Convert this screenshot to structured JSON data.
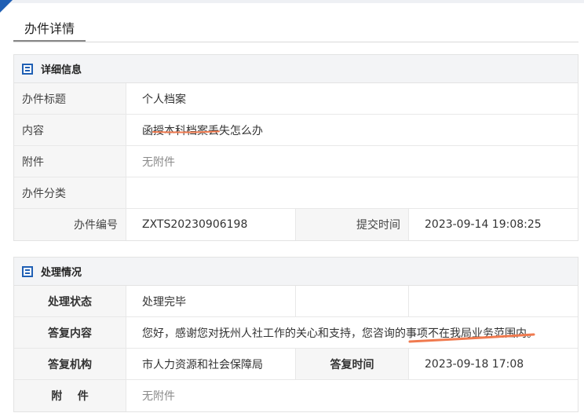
{
  "page": {
    "title": "办件详情"
  },
  "detail": {
    "header": "详细信息",
    "title_label": "办件标题",
    "title_value": "个人档案",
    "content_label": "内容",
    "content_value": "函授本科档案丢失怎么办",
    "attachment_label": "附件",
    "attachment_value": "无附件",
    "category_label": "办件分类",
    "category_value": "",
    "number_label": "办件编号",
    "number_value": "ZXTS20230906198",
    "submit_time_label": "提交时间",
    "submit_time_value": "2023-09-14 19:08:25"
  },
  "handling": {
    "header": "处理情况",
    "status_label": "处理状态",
    "status_value": "处理完毕",
    "reply_label": "答复内容",
    "reply_value": "您好，感谢您对抚州人社工作的关心和支持，您咨询的事项不在我局业务范围内。",
    "org_label": "答复机构",
    "org_value": "市人力资源和社会保障局",
    "reply_time_label": "答复时间",
    "reply_time_value": "2023-09-18 17:08",
    "attachment_label": "附    件",
    "attachment_value": "无附件"
  },
  "colors": {
    "accent": "#1f5fb4",
    "annotation": "#f07a4f"
  },
  "icons": {
    "panel_icon": "list-icon",
    "corner": "corner-triangle-icon"
  }
}
